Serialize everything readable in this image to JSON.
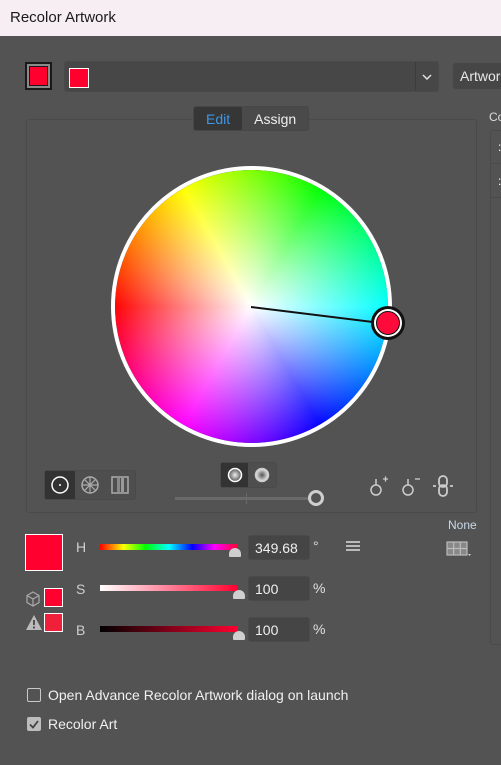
{
  "window": {
    "title": "Recolor Artwork"
  },
  "header": {
    "current_color": "#ff002f",
    "group_chip_color": "#ff002f",
    "artwork_button_label": "Artwork"
  },
  "tabs": [
    {
      "label": "Edit",
      "active": true
    },
    {
      "label": "Assign",
      "active": false
    }
  ],
  "color_wheel": {
    "selected_color": "#ff0a3a",
    "display_modes": [
      "smooth-color-wheel",
      "segmented-color-wheel",
      "color-bars"
    ],
    "active_display_mode": "smooth-color-wheel",
    "ring_modes": [
      "show-saturation",
      "show-brightness"
    ],
    "active_ring_mode": "show-saturation",
    "brightness_slider_value": 1.0,
    "actions": [
      "add-color-tool",
      "remove-color-tool",
      "link-harmony-colors"
    ]
  },
  "hsb": {
    "swatch_color": "#ff002f",
    "out_of_web_color": "#ff002f",
    "out_of_gamut_color": "#f0203a",
    "h": {
      "label": "H",
      "value": "349.68",
      "unit": "°",
      "fraction": 0.971
    },
    "s": {
      "label": "S",
      "value": "100",
      "unit": "%",
      "fraction": 1.0
    },
    "b": {
      "label": "B",
      "value": "100",
      "unit": "%",
      "fraction": 1.0
    }
  },
  "color_library": {
    "label": "None"
  },
  "side_panel": {
    "title": "Co",
    "rows": [
      ":",
      ":"
    ]
  },
  "options": [
    {
      "label": "Open Advance Recolor Artwork dialog on launch",
      "checked": false
    },
    {
      "label": "Recolor Art",
      "checked": true
    }
  ]
}
